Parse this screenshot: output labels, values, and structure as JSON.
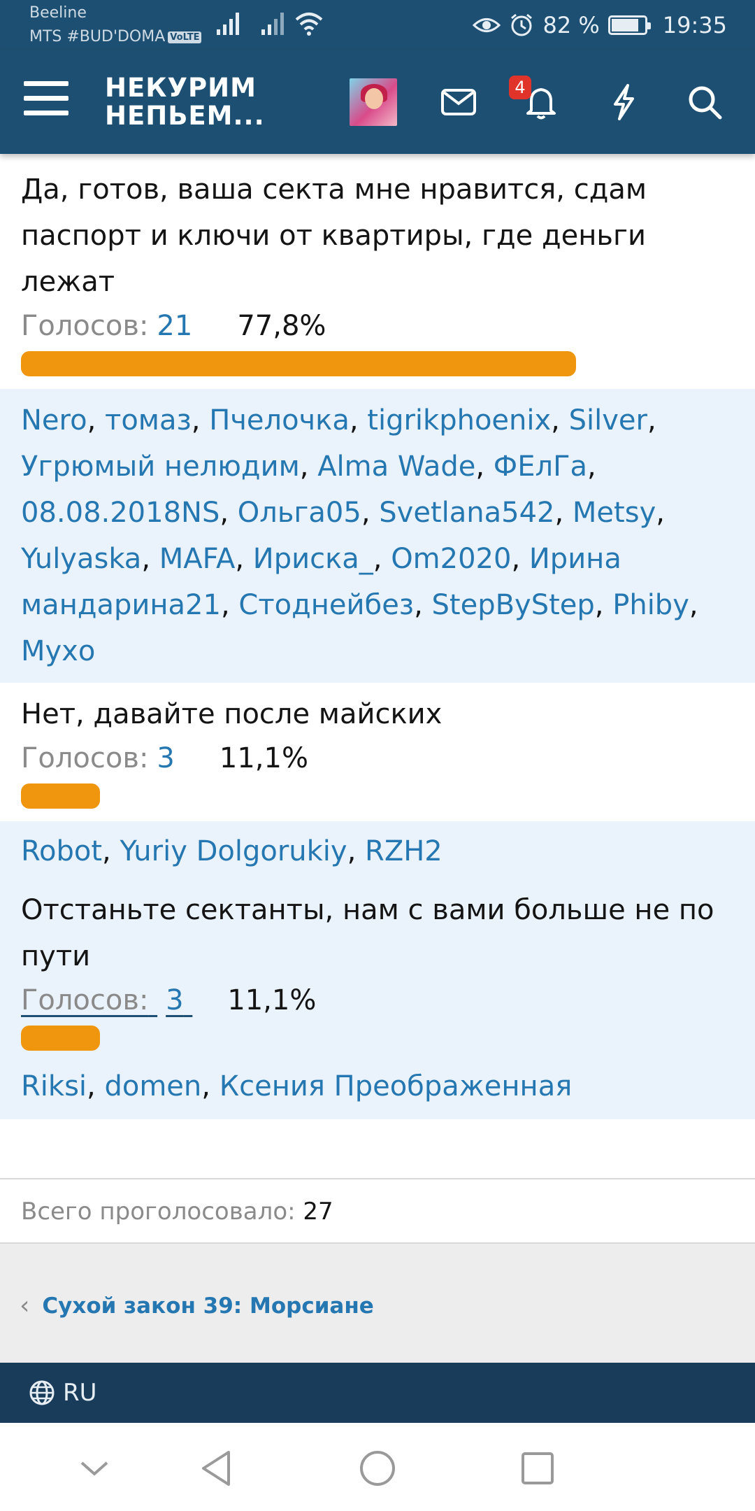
{
  "status_bar": {
    "carrier1": "Beeline",
    "carrier2": "MTS #BUD'DOMA",
    "volte": "VoLTE",
    "battery_percent": "82 %",
    "battery_level": 0.82,
    "time": "19:35"
  },
  "header": {
    "logo_line1": "НЕКУРИМ",
    "logo_line2": "НЕПЬЕМ...",
    "notification_count": "4"
  },
  "poll": {
    "options": [
      {
        "text": "Да, готов, ваша секта мне нравится, сдам паспорт и ключи от квартиры, где деньги лежат",
        "votes_label": "Голосов:",
        "votes": "21",
        "percent": "77,8%",
        "share": 0.778,
        "voters": [
          "Nero",
          "томаз",
          "Пчелочка",
          "tigrikphoenix",
          "Silver",
          "Угрюмый нелюдим",
          "Alma Wade",
          "ФЕлГа",
          "08.08.2018NS",
          "Ольга05",
          "Svetlana542",
          "Metsy",
          "Yulyaska",
          "MAFA",
          "Ириска_",
          "Om2020",
          "Ирина мандарина21",
          "Стоднейбез",
          "StepByStep",
          "Phiby",
          "Мухо"
        ]
      },
      {
        "text": "Нет, давайте после майских",
        "votes_label": "Голосов:",
        "votes": "3",
        "percent": "11,1%",
        "share": 0.111,
        "voters": [
          "Robot",
          "Yuriy Dolgorukiy",
          "RZH2"
        ]
      },
      {
        "text": "Отстаньте сектанты, нам с вами больше не по пути",
        "votes_label": "Голосов:",
        "votes": "3",
        "percent": "11,1%",
        "share": 0.111,
        "voters": [
          "Riksi",
          "domen",
          "Ксения Преображенная"
        ]
      }
    ],
    "total_label": "Всего проголосовало:",
    "total": "27"
  },
  "nav": {
    "prev_thread": "Сухой закон 39: Морсиане"
  },
  "footer": {
    "language": "RU"
  },
  "icons": {
    "menu": "hamburger-icon",
    "mail": "mail-icon",
    "bell": "bell-icon",
    "lightning": "lightning-icon",
    "search": "search-icon",
    "globe": "globe-icon"
  },
  "colors": {
    "header": "#1d4f72",
    "link": "#2577b1",
    "bar": "#ef950e",
    "voters_bg": "#eaf3fc",
    "footer": "#183c5a"
  }
}
